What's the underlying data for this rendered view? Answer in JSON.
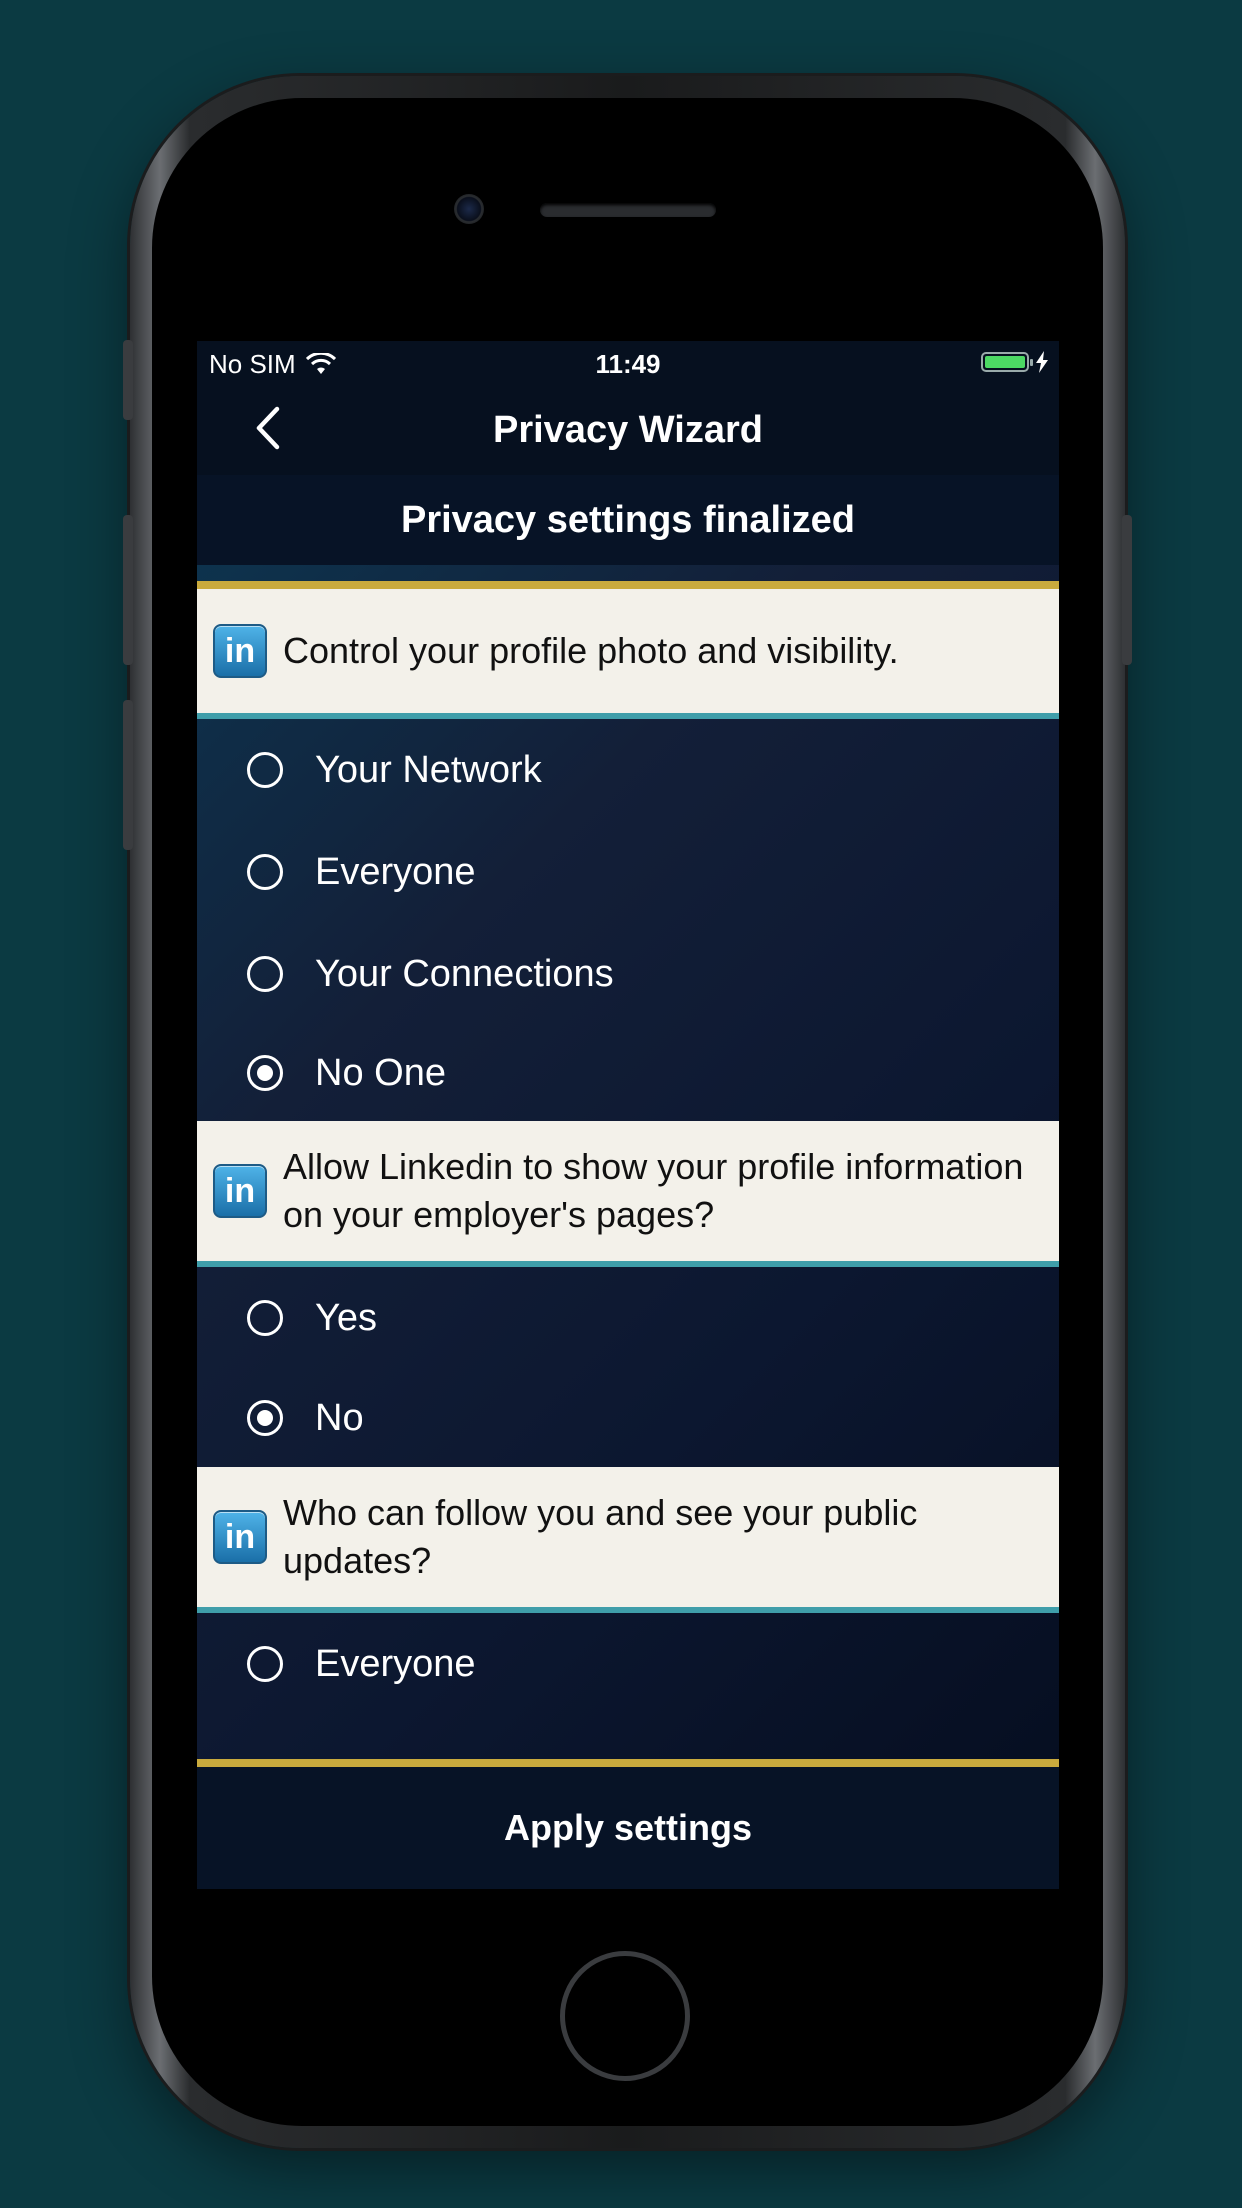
{
  "status_bar": {
    "carrier": "No SIM",
    "time": "11:49",
    "battery_level": 1.0
  },
  "nav": {
    "title": "Privacy Wizard",
    "back_icon": "chevron-left-icon"
  },
  "subtitle": "Privacy settings finalized",
  "questions": [
    {
      "text": "Control your profile photo and visibility.",
      "icon": "linkedin-icon",
      "options": [
        {
          "label": "Your Network",
          "selected": false
        },
        {
          "label": "Everyone",
          "selected": false
        },
        {
          "label": "Your Connections",
          "selected": false
        },
        {
          "label": "No One",
          "selected": true
        }
      ]
    },
    {
      "text": "Allow Linkedin to show your profile information on your employer's pages?",
      "icon": "linkedin-icon",
      "options": [
        {
          "label": "Yes",
          "selected": false
        },
        {
          "label": "No",
          "selected": true
        }
      ]
    },
    {
      "text": "Who can follow you and see your public updates?",
      "icon": "linkedin-icon",
      "options": [
        {
          "label": "Everyone",
          "selected": false
        }
      ]
    }
  ],
  "apply_label": "Apply settings",
  "colors": {
    "accent_gold": "#c9aa3d",
    "question_divider_teal": "#3f9eaa",
    "question_background": "#f3f1ea",
    "battery_green": "#4cd964"
  }
}
